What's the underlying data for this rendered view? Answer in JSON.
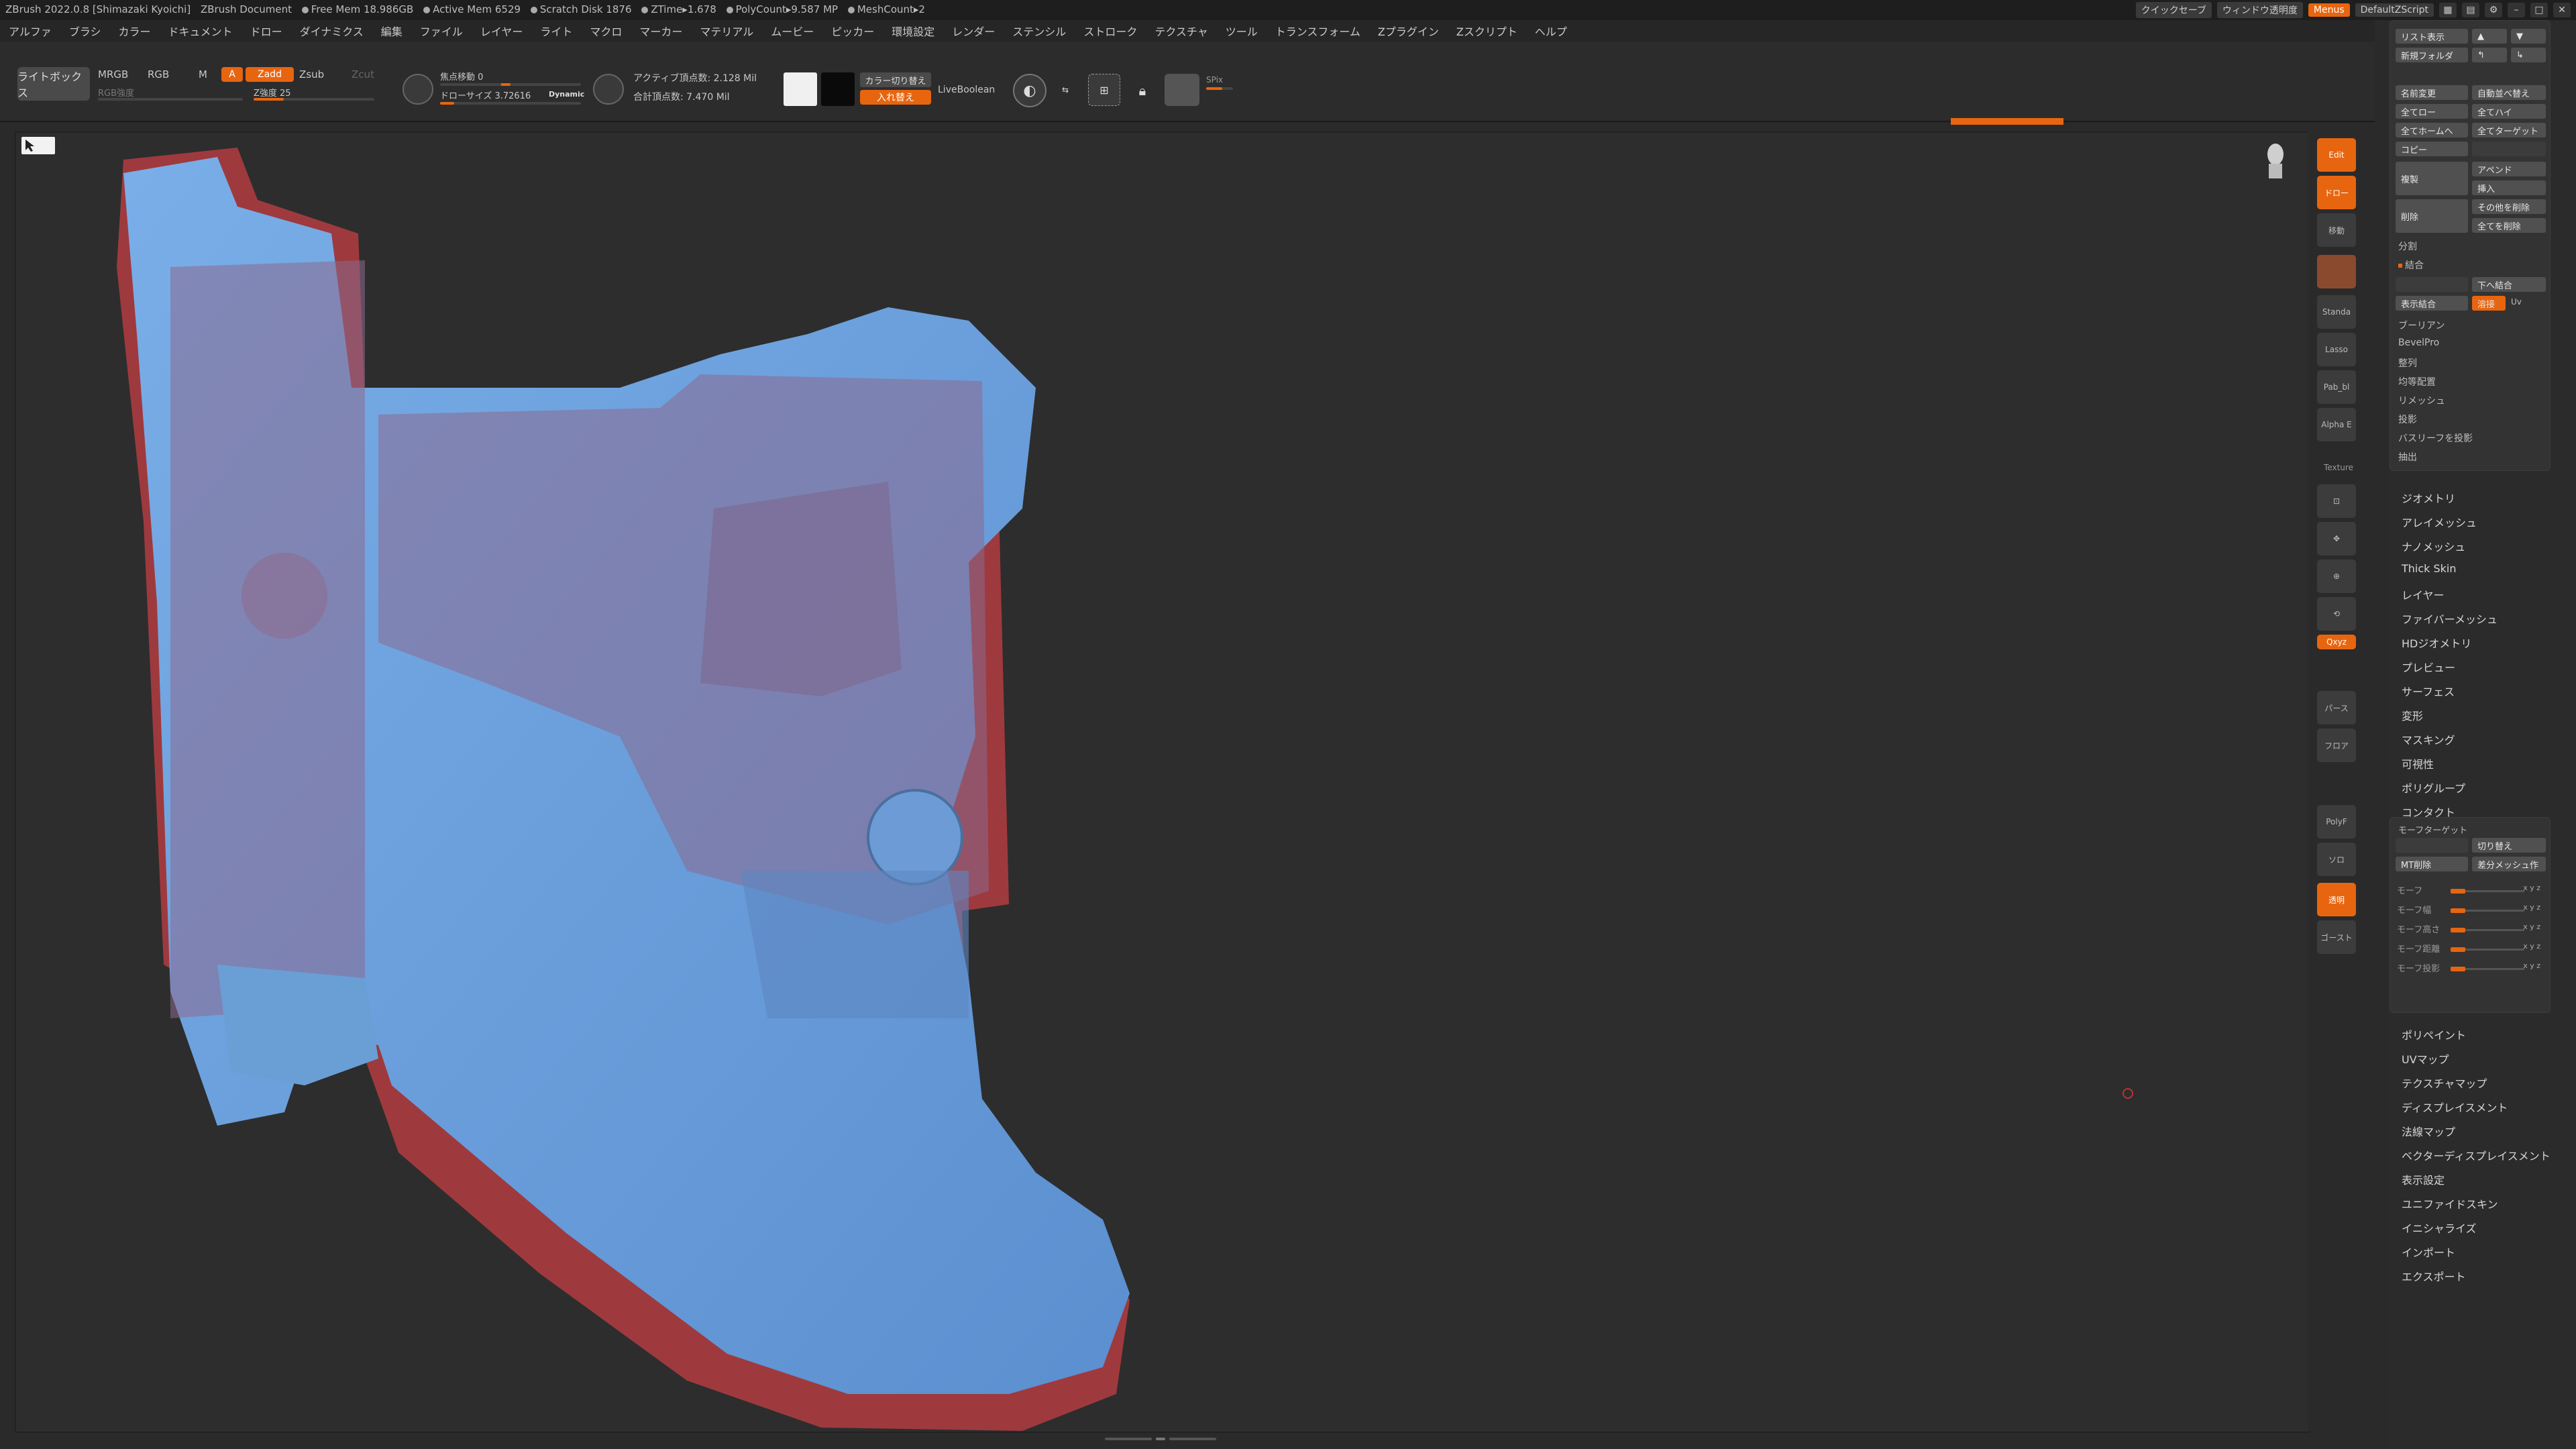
{
  "titlebar": {
    "app": "ZBrush 2022.0.8 [Shimazaki Kyoichi]",
    "document": "ZBrush Document",
    "free_mem": "Free Mem 18.986GB",
    "active_mem": "Active Mem 6529",
    "scratch": "Scratch Disk 1876",
    "ztime": "ZTime▸1.678",
    "polycount": "PolyCount▸9.587 MP",
    "meshcount": "MeshCount▸2",
    "quicksave": "クイックセーブ",
    "window_transparency": "ウィンドウ透明度",
    "menus": "Menus",
    "default_script": "DefaultZScript"
  },
  "menubar": [
    "アルファ",
    "ブラシ",
    "カラー",
    "ドキュメント",
    "ドロー",
    "ダイナミクス",
    "編集",
    "ファイル",
    "レイヤー",
    "ライト",
    "マクロ",
    "マーカー",
    "マテリアル",
    "ムービー",
    "ピッカー",
    "環境設定",
    "レンダー",
    "ステンシル",
    "ストローク",
    "テクスチャ",
    "ツール",
    "トランスフォーム",
    "Zプラグイン",
    "Zスクリプト",
    "ヘルプ"
  ],
  "toolbar": {
    "lightbox": "ライトボックス",
    "mrgb": "MRGB",
    "rgb": "RGB",
    "m": "M",
    "a": "A",
    "zadd": "Zadd",
    "zsub": "Zsub",
    "zcut": "Zcut",
    "rgb_intensity": "RGB強度",
    "z_intensity": "Z強度 25",
    "focal_shift": "焦点移動 0",
    "draw_size": "ドローサイズ 3.72616",
    "dynamic": "Dynamic",
    "active_points": "アクティブ頂点数: 2.128 Mil",
    "total_points": "合計頂点数: 7.470 Mil",
    "color_switch": "カラー切り替え",
    "swap": "入れ替え",
    "livebool": "LiveBoolean",
    "spix": "SPix"
  },
  "right_shelf": {
    "edit": "Edit",
    "move": "ドロー",
    "scale": "移動",
    "standard": "Standa",
    "lasso": "Lasso",
    "matcap": "Pab_bl",
    "alpha": "Alpha E",
    "texture": "Texture",
    "persp": "パース",
    "floor": "フロア",
    "polyf": "PolyF",
    "solo": "ソロ",
    "transp": "透明",
    "ghost": "ゴースト",
    "xyz": "Qxyz"
  },
  "subtool_panel": {
    "list_show": "リスト表示",
    "new_folder": "新規フォルダ",
    "rename": "名前変更",
    "auto_sort": "自動並べ替え",
    "all_low": "全てロー",
    "all_high": "全てハイ",
    "all_home": "全てホームへ",
    "all_target": "全てターゲット",
    "copy": "コピー",
    "paste": "",
    "duplicate": "複製",
    "append": "アペンド",
    "insert": "挿入",
    "delete": "削除",
    "delete_other": "その他を削除",
    "delete_all": "全てを削除",
    "split": "分割",
    "merge": "結合",
    "merge_down": "下へ結合",
    "merge_visible": "表示結合",
    "weld": "溶接",
    "uv": "Uv",
    "boolean": "ブーリアン",
    "bevelpro": "BevelPro",
    "align": "整列",
    "distribute": "均等配置",
    "remesh": "リメッシュ",
    "project": "投影",
    "project_bas": "バスリーフを投影",
    "extract": "抽出"
  },
  "tool_menu": [
    "ジオメトリ",
    "アレイメッシュ",
    "ナノメッシュ",
    "Thick Skin",
    "レイヤー",
    "ファイバーメッシュ",
    "HDジオメトリ",
    "プレビュー",
    "サーフェス",
    "変形",
    "マスキング",
    "可視性",
    "ポリグループ",
    "コンタクト"
  ],
  "morph_panel": {
    "title": "モーフターゲット",
    "switch": "切り替え",
    "mt_delete": "MT削除",
    "diff_mesh": "差分メッシュ作",
    "sliders": [
      {
        "label": "モーフ",
        "value": 0.2
      },
      {
        "label": "モーフ幅",
        "value": 0.2
      },
      {
        "label": "モーフ高さ",
        "value": 0.2
      },
      {
        "label": "モーフ距離",
        "value": 0.2
      },
      {
        "label": "モーフ投影",
        "value": 0.2
      }
    ],
    "xyz": "x y z"
  },
  "tool_menu2": [
    "ポリペイント",
    "UVマップ",
    "テクスチャマップ",
    "ディスプレイスメント",
    "法線マップ",
    "ベクターディスプレイスメント",
    "表示設定",
    "ユニファイドスキン",
    "イニシャライズ",
    "インポート",
    "エクスポート"
  ],
  "colors": {
    "accent": "#e8650f",
    "mesh_blue": "#6a9fd6",
    "mesh_red": "#9e3a3e"
  }
}
